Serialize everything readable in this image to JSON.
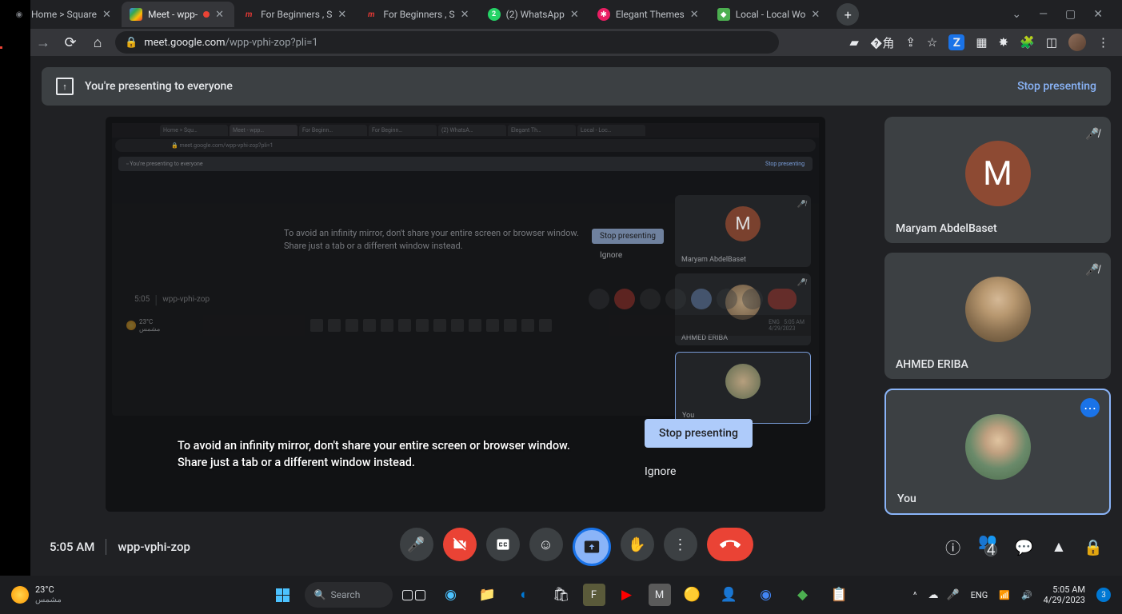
{
  "browser": {
    "tabs": [
      {
        "title": "Home > Square",
        "favicon": "◉",
        "favcolor": "#7a7d82"
      },
      {
        "title": "Meet - wpp-",
        "favicon": "◍",
        "favcolor": "#34a853",
        "active": true,
        "recording": true
      },
      {
        "title": "For Beginners , S",
        "favicon": "m",
        "favcolor": "#e53935"
      },
      {
        "title": "For Beginners , S",
        "favicon": "m",
        "favcolor": "#e53935"
      },
      {
        "title": "(2) WhatsApp",
        "favicon": "2",
        "favcolor": "#25d366"
      },
      {
        "title": "Elegant Themes",
        "favicon": "✱",
        "favcolor": "#e91e63"
      },
      {
        "title": "Local - Local Wo",
        "favicon": "◆",
        "favcolor": "#4caf50"
      }
    ],
    "url_host": "meet.google.com",
    "url_path": "/wpp-vphi-zop?pli=1"
  },
  "meet": {
    "banner_text": "You're presenting to everyone",
    "stop_presenting": "Stop presenting",
    "hint_line1": "To avoid an infinity mirror, don't share your entire screen or browser window.",
    "hint_line2": "Share just a tab or a different window instead.",
    "ignore": "Ignore",
    "time": "5:05 AM",
    "code": "wpp-vphi-zop",
    "participant_count": "4",
    "participants": [
      {
        "name": "Maryam AbdelBaset",
        "initial": "M",
        "muted": true,
        "type": "letter"
      },
      {
        "name": "AHMED ERIBA",
        "muted": true,
        "type": "photo1"
      },
      {
        "name": "You",
        "type": "photo2",
        "selected": true,
        "more": true
      }
    ],
    "mirror": {
      "banner": "You're presenting to everyone",
      "stop": "Stop presenting",
      "p1": "Maryam AbdelBaset",
      "p2": "AHMED ERIBA",
      "p3": "You",
      "time": "5:05"
    }
  },
  "taskbar": {
    "temp": "23°C",
    "cond": "مشمس",
    "search": "Search",
    "lang": "ENG",
    "time": "5:05 AM",
    "date": "4/29/2023",
    "notif": "3"
  }
}
